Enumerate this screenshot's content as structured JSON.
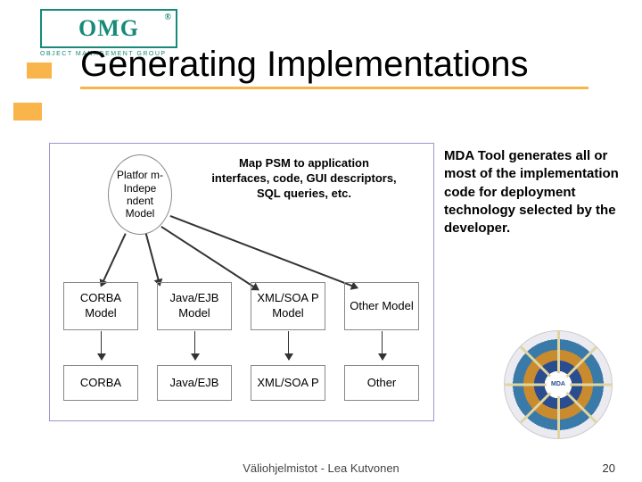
{
  "logo": {
    "text": "OMG",
    "reg": "®",
    "subtitle": "OBJECT MANAGEMENT GROUP"
  },
  "title": "Generating Implementations",
  "diagram": {
    "pim": "Platfor m-Indepe ndent Model",
    "map_text": "Map PSM to application interfaces, code, GUI descriptors, SQL queries, etc.",
    "models": [
      "CORBA Model",
      "Java/EJB Model",
      "XML/SOA P Model",
      "Other Model"
    ],
    "impls": [
      "CORBA",
      "Java/EJB",
      "XML/SOA P",
      "Other"
    ]
  },
  "side_text": "MDA Tool generates all or most of the implementation code for deployment technology selected by the developer.",
  "mda_core": "MDA",
  "footer": "Väliohjelmistot - Lea Kutvonen",
  "page": "20"
}
